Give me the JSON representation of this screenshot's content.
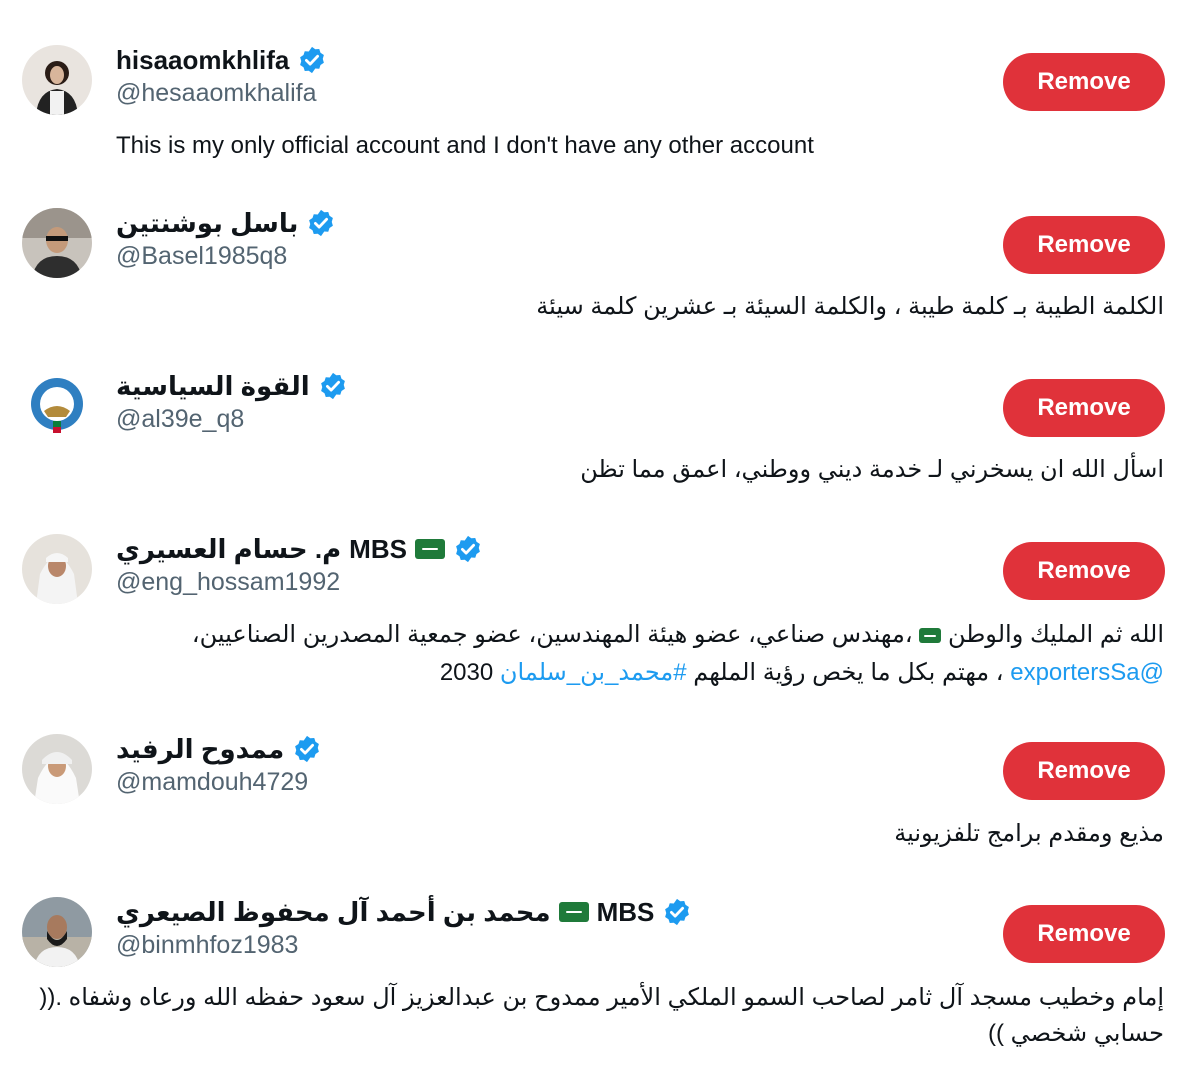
{
  "remove_label": "Remove",
  "accent_color": "#e0323a",
  "link_color": "#1d9bf0",
  "verified_icon": "verified-badge-icon",
  "flag_icon": "saudi-flag-icon",
  "accounts": [
    {
      "display_name": "hisaaomkhlifa",
      "handle": "@hesaaomkhalifa",
      "bio": "This is my only official account and I don't have any other account"
    },
    {
      "display_name": "باسل بوشنتين",
      "handle": "@Basel1985q8",
      "bio": "الكلمة الطيبة بـ كلمة طيبة ، والكلمة السيئة بـ عشرين كلمة سيئة"
    },
    {
      "display_name": "القوة السياسية",
      "handle": "@al39e_q8",
      "bio": "اسأل الله ان يسخرني لـ خدمة ديني ووطني، اعمق مما تظن"
    },
    {
      "display_name_prefix": "MBS",
      "display_name": "م. حسام العسيري",
      "handle": "@eng_hossam1992",
      "bio_line1_a": "الله ثم المليك والوطن",
      "bio_line1_b": "،مهندس صناعي، عضو هيئة المهندسين، عضو جمعية المصدرين الصناعيين،",
      "bio_line2_mention": "@exportersSa",
      "bio_line2_text": "، مهتم بكل ما يخص رؤية الملهم",
      "bio_line2_hashtag": "#محمد_بن_سلمان",
      "bio_line2_end": "2030"
    },
    {
      "display_name": "ممدوح الرفيد",
      "handle": "@mamdouh4729",
      "bio": "مذيع ومقدم برامج تلفزيونية"
    },
    {
      "display_name_prefix": "MBS",
      "display_name": "محمد بن أحمد آل محفوظ الصيعري",
      "handle": "@binmhfoz1983",
      "bio_line1": "إمام وخطيب مسجد آل ثامر لصاحب السمو الملكي الأمير ممدوح بن عبدالعزيز آل سعود حفظه الله ورعاه وشفاه .((",
      "bio_line2": "حسابي شخصي ))"
    }
  ]
}
